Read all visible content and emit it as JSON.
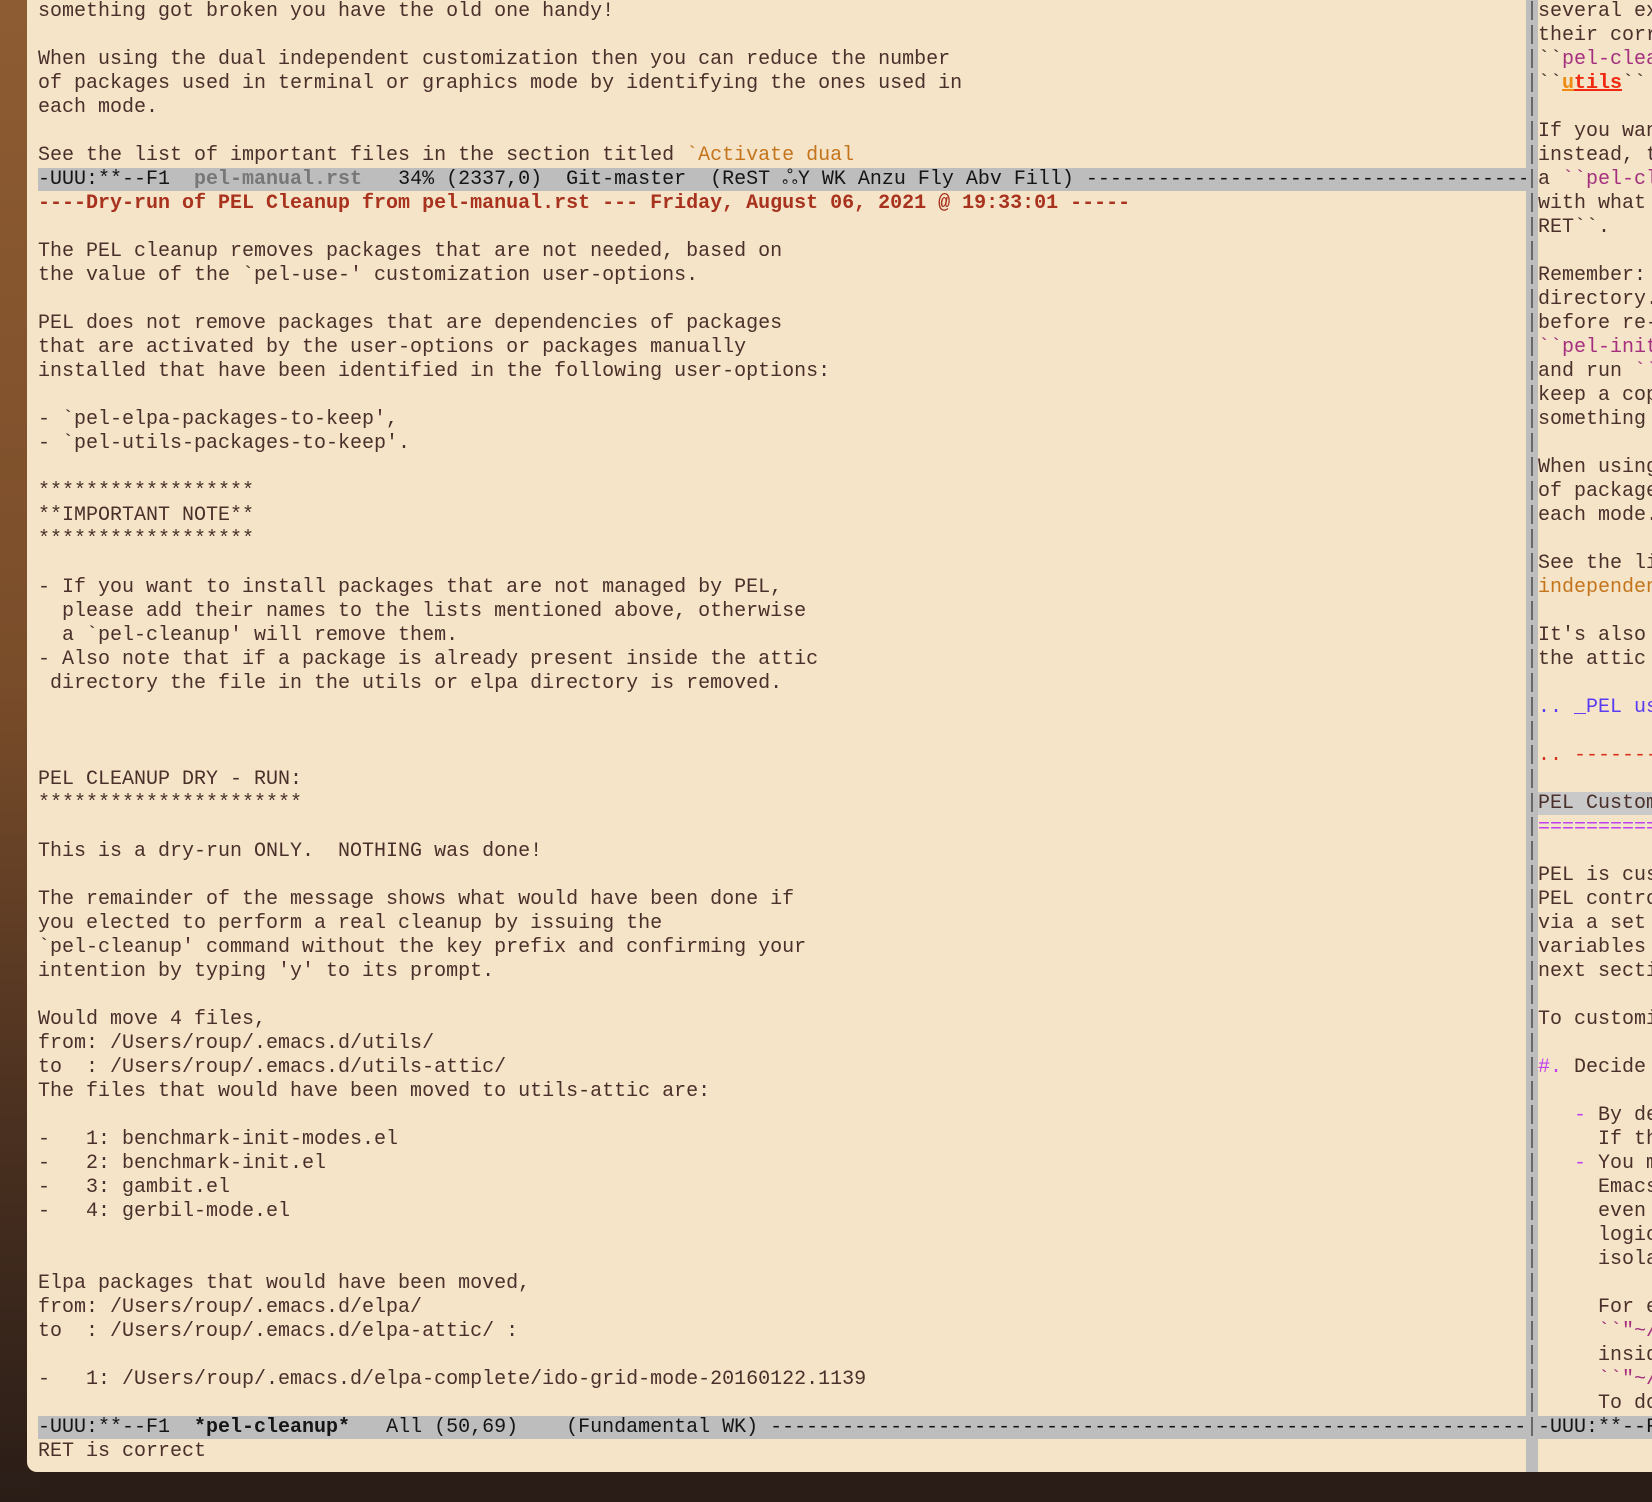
{
  "colors": {
    "background": "#f5e4c8",
    "text": "#4a2f2a",
    "mode_line": "#bdbdbd",
    "header_red": "#a8321e",
    "link_orange": "#c4741c",
    "rst_magenta": "#a4307e",
    "rst_blue": "#5a3cf5",
    "rst_purple": "#c040f0"
  },
  "top_window": {
    "lines": [
      "something got broken you have the old one handy!",
      "",
      "When using the dual independent customization then you can reduce the number",
      "of packages used in terminal or graphics mode by identifying the ones used in",
      "each mode.",
      "",
      [
        [
          "See the list of important files in the section titled ",
          "n"
        ],
        [
          "`Activate dual",
          "or"
        ]
      ]
    ],
    "mode_line": {
      "state": "-UUU:**--F1  ",
      "buffer": "pel-manual.rst",
      "position": "   34% (2337,0)  Git-master  (ReST ",
      "icon": "ஃY",
      "icon_name": "rest-mode-icon",
      "modes": " WK Anzu Fly Abv Fill) ",
      "fill": "------------------------------------------------------------------------------------------------"
    }
  },
  "bottom_window": {
    "lines": [
      [
        [
          "----Dry-run of PEL Cleanup from pel-manual.rst --- Friday, August 06, 2021 @ 19:33:01 -----",
          "rh"
        ]
      ],
      "",
      "The PEL cleanup removes packages that are not needed, based on",
      "the value of the `pel-use-' customization user-options.",
      "",
      "PEL does not remove packages that are dependencies of packages",
      "that are activated by the user-options or packages manually",
      "installed that have been identified in the following user-options:",
      "",
      "- `pel-elpa-packages-to-keep',",
      "- `pel-utils-packages-to-keep'.",
      "",
      "******************",
      "**IMPORTANT NOTE**",
      "******************",
      "",
      "- If you want to install packages that are not managed by PEL,",
      "  please add their names to the lists mentioned above, otherwise",
      "  a `pel-cleanup' will remove them.",
      "- Also note that if a package is already present inside the attic",
      " directory the file in the utils or elpa directory is removed.",
      "",
      "",
      "",
      "PEL CLEANUP DRY - RUN:",
      "**********************",
      "",
      "This is a dry-run ONLY.  NOTHING was done!",
      "",
      "The remainder of the message shows what would have been done if",
      "you elected to perform a real cleanup by issuing the",
      "`pel-cleanup' command without the key prefix and confirming your",
      "intention by typing 'y' to its prompt.",
      "",
      "Would move 4 files,",
      "from: /Users/roup/.emacs.d/utils/",
      "to  : /Users/roup/.emacs.d/utils-attic/",
      "The files that would have been moved to utils-attic are:",
      "",
      "-   1: benchmark-init-modes.el",
      "-   2: benchmark-init.el",
      "-   3: gambit.el",
      "-   4: gerbil-mode.el",
      "",
      "",
      "Elpa packages that would have been moved,",
      "from: /Users/roup/.emacs.d/elpa/",
      "to  : /Users/roup/.emacs.d/elpa-attic/ :",
      "",
      "-   1: /Users/roup/.emacs.d/elpa-complete/ido-grid-mode-20160122.1139",
      ""
    ],
    "mode_line": {
      "state": "-UUU:**--F1  ",
      "buffer": "*pel-cleanup*",
      "position": "   All (50,69)    (Fundamental WK) ",
      "fill": "------------------------------------------------------------------------------------------------------------"
    }
  },
  "right_window": {
    "lines": [
      "several ex",
      "their corr",
      [
        [
          "``",
          "n"
        ],
        [
          "pel-clea",
          "mg"
        ]
      ],
      [
        [
          "``",
          "n"
        ],
        [
          "u",
          "uo"
        ],
        [
          "tils",
          "ul"
        ],
        [
          "``",
          "n"
        ]
      ],
      "",
      "If you wan",
      "instead, t",
      [
        [
          "a ",
          "n"
        ],
        [
          "``pel-cl",
          "mg"
        ]
      ],
      "with what ",
      "RET``.",
      "",
      "Remember: ",
      "directory.",
      "before re-",
      [
        [
          "``pel-init",
          "mg"
        ]
      ],
      [
        [
          "and run ",
          "n"
        ],
        [
          "``",
          "mg"
        ]
      ],
      "keep a cop",
      "something ",
      "",
      "When using",
      "of package",
      "each mode.",
      "",
      "See the li",
      [
        [
          "independen",
          "or"
        ]
      ],
      "",
      "It's also ",
      "the attic ",
      "",
      [
        [
          ".. _PEL us",
          "bl"
        ]
      ],
      "",
      [
        [
          ".. -------",
          "rd"
        ]
      ],
      "",
      [
        [
          "PEL Custom",
          "hl"
        ]
      ],
      [
        [
          "==========",
          "pu"
        ]
      ],
      "",
      "PEL is cus",
      "PEL contro",
      "via a set ",
      "variables ",
      "next secti",
      "",
      "To customi",
      "",
      [
        [
          "#.",
          "pu"
        ],
        [
          " Decide ",
          "n"
        ]
      ],
      "",
      [
        [
          "   ",
          "n"
        ],
        [
          "-",
          "pu"
        ],
        [
          " By de",
          "n"
        ]
      ],
      "     If th",
      [
        [
          "   ",
          "n"
        ],
        [
          "-",
          "pu"
        ],
        [
          " You m",
          "n"
        ]
      ],
      "     Emacs",
      "     even ",
      "     logic",
      "     isola",
      "",
      "     For e",
      [
        [
          "     ",
          "n"
        ],
        [
          "``\"~/",
          "mg"
        ]
      ],
      "     insid",
      [
        [
          "     ",
          "n"
        ],
        [
          "``\"~/",
          "mg"
        ]
      ],
      "     To do"
    ],
    "mode_line": {
      "state": "-UUU:**--F"
    }
  },
  "echo_area": {
    "message": "RET is correct"
  },
  "divider_char": "|"
}
